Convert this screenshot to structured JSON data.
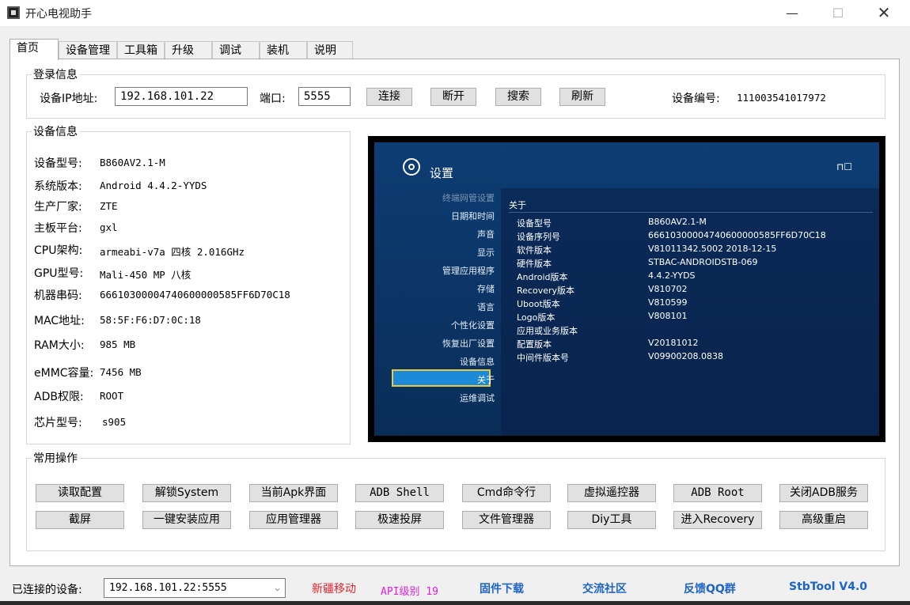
{
  "window": {
    "title": "开心电视助手",
    "min_glyph": "—",
    "max_glyph": "☐",
    "close_glyph": "✕"
  },
  "tabs": [
    "首页",
    "设备管理",
    "工具箱",
    "升级",
    "调试",
    "装机",
    "说明"
  ],
  "login": {
    "legend": "登录信息",
    "ip_label": "设备IP地址:",
    "ip_value": "192.168.101.22",
    "port_label": "端口:",
    "port_value": "5555",
    "buttons": [
      "连接",
      "断开",
      "搜索",
      "刷新"
    ],
    "serial_label": "设备编号:",
    "serial_value": "111003541017972"
  },
  "device_info": {
    "legend": "设备信息",
    "rows": [
      {
        "label": "设备型号:",
        "value": "B860AV2.1-M"
      },
      {
        "label": "系统版本:",
        "value": "Android 4.4.2-YYDS"
      },
      {
        "label": "生产厂家:",
        "value": "ZTE"
      },
      {
        "label": "主板平台:",
        "value": "gxl"
      },
      {
        "label": "CPU架构:",
        "value": "armeabi-v7a 四核 2.016GHz"
      },
      {
        "label": "GPU型号:",
        "value": "Mali-450 MP 八核"
      },
      {
        "label": "机器串码:",
        "value": "66610300004740600000585FF6D70C18"
      },
      {
        "label": "MAC地址:",
        "value": "58:5F:F6:D7:0C:18"
      },
      {
        "label": "RAM大小:",
        "value": "985 MB"
      },
      {
        "label": "eMMC容量:",
        "value": "7456 MB"
      },
      {
        "label": "ADB权限:",
        "value": "ROOT"
      },
      {
        "label": "芯片型号:",
        "value": "s905"
      }
    ]
  },
  "screen": {
    "title": "设置",
    "net_icon_text": "⊓☐",
    "menu": [
      "终端网管设置",
      "日期和时间",
      "声音",
      "显示",
      "管理应用程序",
      "存储",
      "语言",
      "个性化设置",
      "恢复出厂设置",
      "设备信息",
      "关于",
      "运维调试"
    ],
    "about_title": "关于",
    "rows": [
      {
        "k": "设备型号",
        "v": "B860AV2.1-M"
      },
      {
        "k": "设备序列号",
        "v": "66610300004740600000585FF6D70C18"
      },
      {
        "k": "软件版本",
        "v": "V81011342.5002 2018-12-15"
      },
      {
        "k": "硬件版本",
        "v": "STBAC-ANDROIDSTB-069"
      },
      {
        "k": "Android版本",
        "v": "4.4.2-YYDS"
      },
      {
        "k": "Recovery版本",
        "v": "V810702"
      },
      {
        "k": "Uboot版本",
        "v": "V810599"
      },
      {
        "k": "Logo版本",
        "v": "V808101"
      },
      {
        "k": "应用或业务版本",
        "v": ""
      },
      {
        "k": "配置版本",
        "v": "V20181012"
      },
      {
        "k": "中间件版本号",
        "v": "V09900208.0838"
      }
    ]
  },
  "ops": {
    "legend": "常用操作",
    "row1": [
      "读取配置",
      "解锁System",
      "当前Apk界面",
      "ADB Shell",
      "Cmd命令行",
      "虚拟遥控器",
      "ADB  Root",
      "关闭ADB服务"
    ],
    "row2": [
      "截屏",
      "一键安装应用",
      "应用管理器",
      "极速投屏",
      "文件管理器",
      "Diy工具",
      "进入Recovery",
      "高级重启"
    ]
  },
  "status": {
    "connected_label": "已连接的设备:",
    "connected_value": "192.168.101.22:5555",
    "arrow": "⌵",
    "carrier": "新疆移动",
    "api": "API级别 19",
    "firmware": "固件下载",
    "community": "交流社区",
    "feedback": "反馈QQ群",
    "version": "StbTool V4.0",
    "colors": {
      "carrier": "#e8242c",
      "api": "#e020e0",
      "links": "#1e64c8"
    }
  }
}
